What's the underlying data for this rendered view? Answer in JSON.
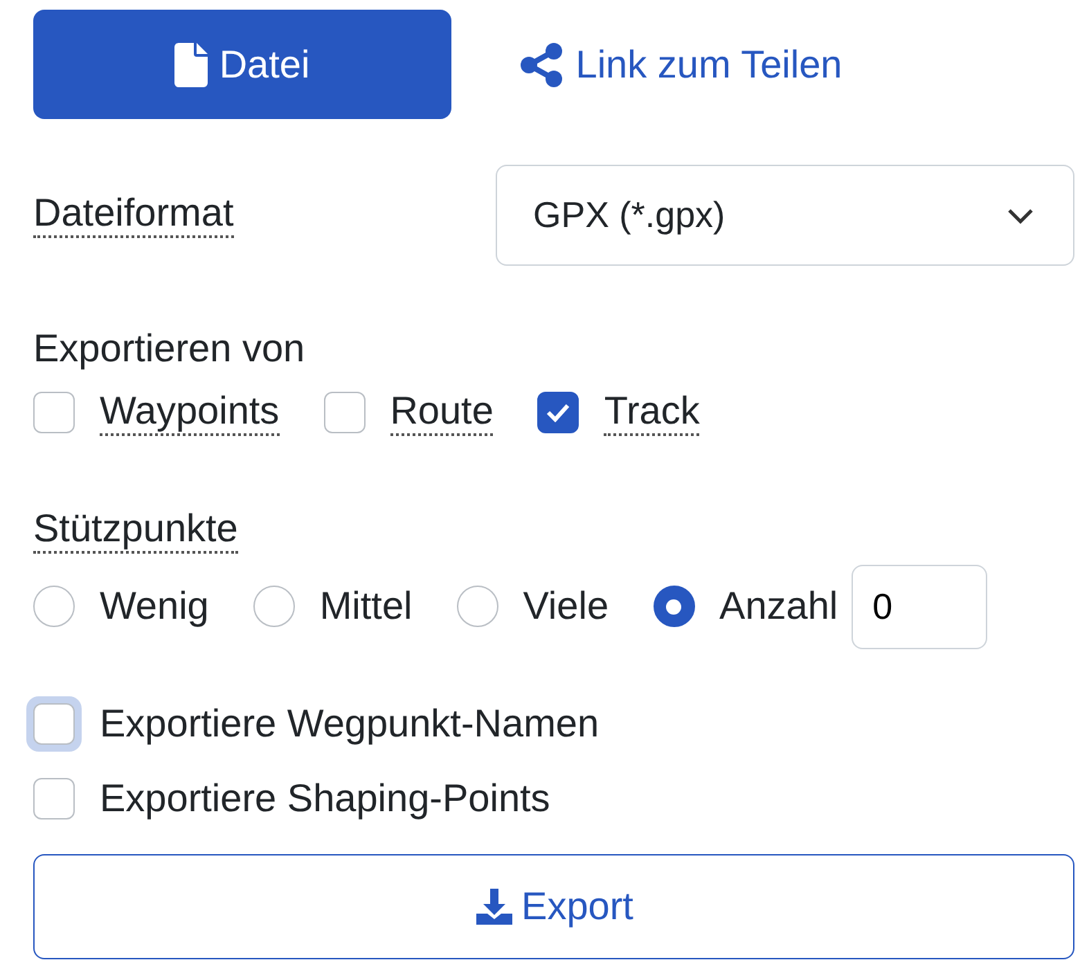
{
  "tabs": [
    {
      "label": "Datei",
      "kind": "file",
      "selected": true
    },
    {
      "label": "Link zum Teilen",
      "kind": "share",
      "selected": false
    }
  ],
  "format": {
    "label": "Dateiformat",
    "value": "GPX (*.gpx)"
  },
  "export_from": {
    "label": "Exportieren von",
    "options": [
      {
        "label": "Waypoints",
        "checked": false
      },
      {
        "label": "Route",
        "checked": false
      },
      {
        "label": "Track",
        "checked": true
      }
    ]
  },
  "points": {
    "label": "Stützpunkte",
    "options": [
      {
        "label": "Wenig",
        "selected": false
      },
      {
        "label": "Mittel",
        "selected": false
      },
      {
        "label": "Viele",
        "selected": false
      },
      {
        "label": "Anzahl",
        "selected": true
      }
    ],
    "count": "0"
  },
  "options": [
    {
      "label": "Exportiere Wegpunkt-Namen",
      "checked": false,
      "focused": true
    },
    {
      "label": "Exportiere Shaping-Points",
      "checked": false,
      "focused": false
    }
  ],
  "export_button": "Export"
}
